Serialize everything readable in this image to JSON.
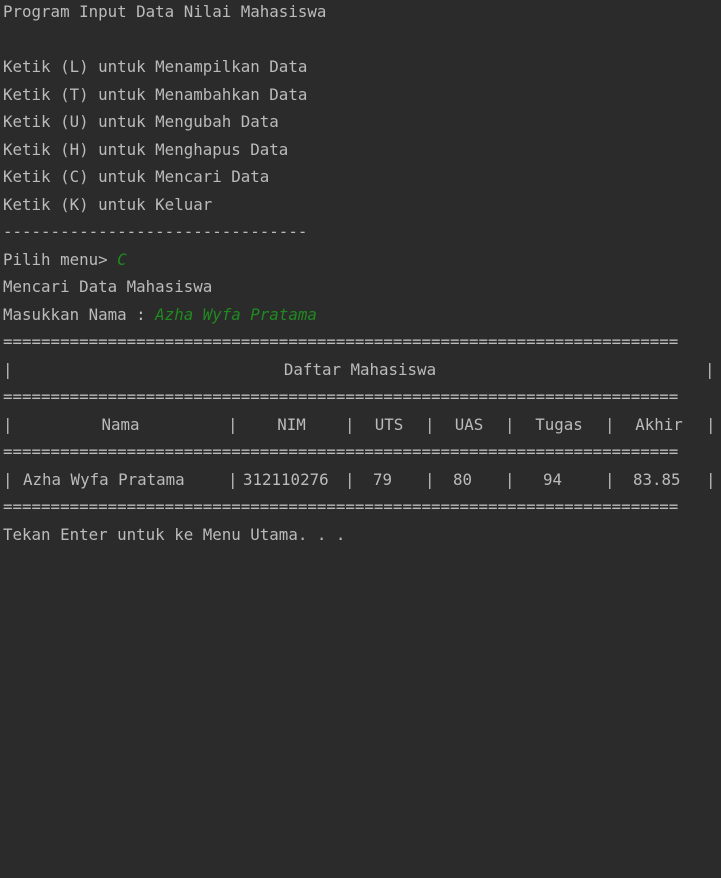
{
  "title": "Program Input Data Nilai Mahasiswa",
  "menu": [
    "Ketik (L) untuk Menampilkan Data",
    "Ketik (T) untuk Menambahkan Data",
    "Ketik (U) untuk Mengubah Data",
    "Ketik (H) untuk Menghapus Data",
    "Ketik (C) untuk Mencari Data",
    "Ketik (K) untuk Keluar"
  ],
  "divider": "--------------------------------",
  "prompt": {
    "label": "Pilih menu> ",
    "value": "C"
  },
  "section_title": "Mencari Data Mahasiswa",
  "name_prompt": {
    "label": "Masukkan Nama : ",
    "value": "Azha Wyfa Pratama"
  },
  "separator": "=======================================================================",
  "table": {
    "title": "Daftar Mahasiswa",
    "headers": [
      "Nama",
      "NIM",
      "UTS",
      "UAS",
      "Tugas",
      "Akhir"
    ],
    "rows": [
      [
        "Azha Wyfa Pratama",
        "312110276",
        "79",
        "80",
        "94",
        "83.85"
      ]
    ]
  },
  "footer": "Tekan Enter untuk ke Menu Utama. . ."
}
